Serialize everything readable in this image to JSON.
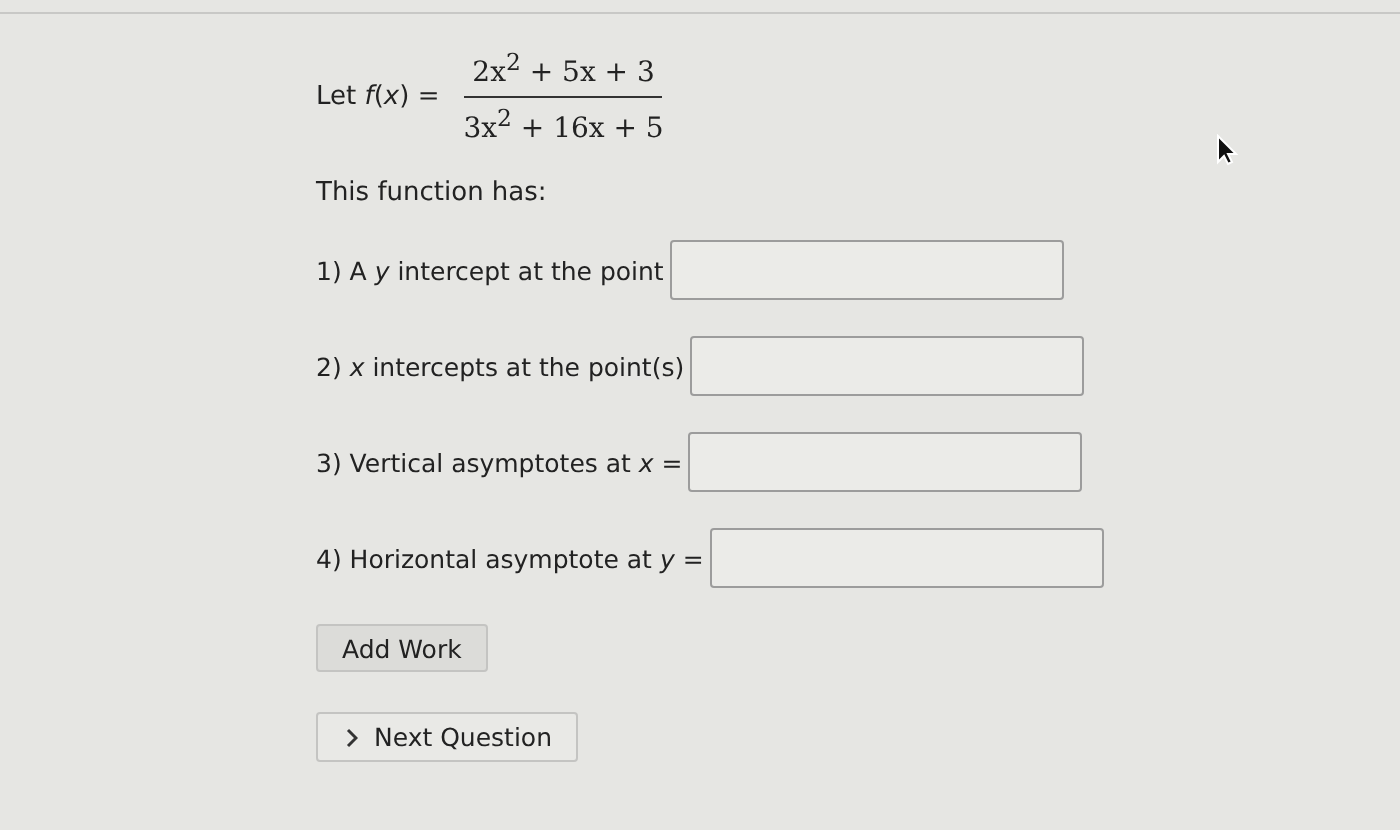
{
  "function": {
    "lead": "Let *f*(*x*) =",
    "numerator": "2x$^{2}$ + 5x + 3",
    "denominator": "3x$^{2}$ + 16x + 5"
  },
  "intro": "This function has:",
  "questions": [
    {
      "label": "1) A *y* intercept at the point"
    },
    {
      "label": "2) *x* intercepts at the point(s)"
    },
    {
      "label": "3) Vertical asymptotes at *x* ="
    },
    {
      "label": "4) Horizontal asymptote at *y* ="
    }
  ],
  "buttons": [
    {
      "kind": "plain",
      "label": "Add Work"
    },
    {
      "kind": "next",
      "label": "Next Question"
    }
  ]
}
